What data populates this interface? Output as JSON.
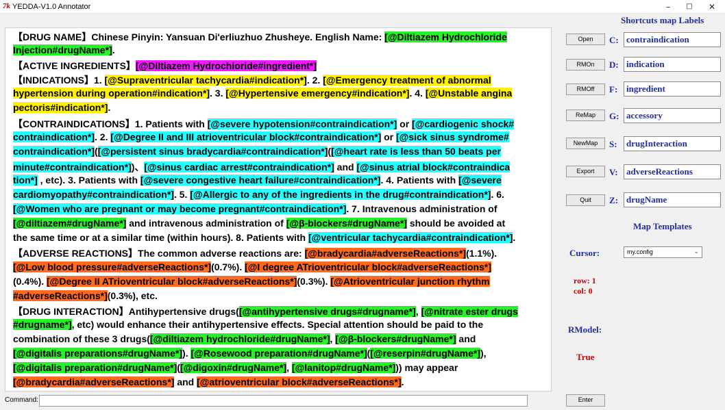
{
  "window": {
    "icon_text": "7k",
    "title": "YEDDA-V1.0 Annotator",
    "controls": [
      "–",
      "□",
      "✕"
    ]
  },
  "colors": {
    "drugName": "#2bef2b",
    "indication": "#fff200",
    "contraindication": "#27ffff",
    "ingredient": "#f218ff",
    "adverseReactions": "#ff6a1f",
    "label_blue": "#1f2fa0",
    "status_red": "#d00000"
  },
  "editor_lines": [
    [
      {
        "t": "【DRUG NAME】Chinese Pinyin: Yansuan Di'erliuzhuo Zhusheye. English Name: "
      },
      {
        "t": "[@Diltiazem Hydrochloride",
        "h": "g"
      }
    ],
    [
      {
        "t": "Injection#drugName*]",
        "h": "g"
      },
      {
        "t": "."
      }
    ],
    [
      {
        "t": "【ACTIVE INGREDIENTS】"
      },
      {
        "t": "[@Diltiazem Hydrochloride#ingredient*]",
        "h": "m"
      }
    ],
    [
      {
        "t": "【INDICATIONS】1. "
      },
      {
        "t": "[@Supraventricular tachycardia#indication*]",
        "h": "y"
      },
      {
        "t": ". 2. "
      },
      {
        "t": "[@Emergency treatment of abnormal",
        "h": "y"
      }
    ],
    [
      {
        "t": "hypertension during operation#indication*]",
        "h": "y"
      },
      {
        "t": ". 3. "
      },
      {
        "t": "[@Hypertensive emergency#indication*]",
        "h": "y"
      },
      {
        "t": ". 4. "
      },
      {
        "t": "[@Unstable angina",
        "h": "y"
      }
    ],
    [
      {
        "t": "pectoris#indication*]",
        "h": "y"
      },
      {
        "t": "."
      }
    ],
    [
      {
        "t": "【CONTRAINDICATIONS】1. Patients with "
      },
      {
        "t": "[@severe hypotension#contraindication*]",
        "h": "c"
      },
      {
        "t": " or "
      },
      {
        "t": "[@cardiogenic shock#",
        "h": "c"
      }
    ],
    [
      {
        "t": "contraindication*]",
        "h": "c"
      },
      {
        "t": ". 2. "
      },
      {
        "t": "[@Degree II and III atrioventricular block#contraindication*]",
        "h": "c"
      },
      {
        "t": " or "
      },
      {
        "t": "[@sick sinus syndrome#",
        "h": "c"
      }
    ],
    [
      {
        "t": "contraindication*]",
        "h": "c"
      },
      {
        "t": "("
      },
      {
        "t": "[@persistent sinus bradycardia#contraindication*]",
        "h": "c"
      },
      {
        "t": "("
      },
      {
        "t": "[@heart rate is less than 50 beats per",
        "h": "c"
      }
    ],
    [
      {
        "t": "minute#contraindication*]",
        "h": "c"
      },
      {
        "t": ")、"
      },
      {
        "t": "[@sinus cardiac arrest#contraindication*]",
        "h": "c"
      },
      {
        "t": " and "
      },
      {
        "t": "[@sinus atrial block#contraindica",
        "h": "c"
      }
    ],
    [
      {
        "t": "tion*]",
        "h": "c"
      },
      {
        "t": " , etc). 3. Patients with "
      },
      {
        "t": "[@severe congestive heart failure#contraindication*]",
        "h": "c"
      },
      {
        "t": ". 4.  Patients with "
      },
      {
        "t": "[@severe",
        "h": "c"
      }
    ],
    [
      {
        "t": "cardiomyopathy#contraindication*]",
        "h": "c"
      },
      {
        "t": ". 5.  "
      },
      {
        "t": "[@Allergic to any of the ingredients in the drug#contraindication*]",
        "h": "c"
      },
      {
        "t": ". 6."
      }
    ],
    [
      {
        "t": "[@Women who are pregnant or may become pregnant#contraindication*]",
        "h": "c"
      },
      {
        "t": ". 7. Intravenous administration of"
      }
    ],
    [
      {
        "t": "[@diltiazem#drugName*]",
        "h": "g"
      },
      {
        "t": " and intravenous administration of "
      },
      {
        "t": "[@β-blockers#drugName*]",
        "h": "g"
      },
      {
        "t": " should be avoided at"
      }
    ],
    [
      {
        "t": "the same time or at a similar time (within hours). 8.  Patients with "
      },
      {
        "t": "[@ventricular tachycardia#contraindication*]",
        "h": "c"
      },
      {
        "t": "."
      }
    ],
    [
      {
        "t": "【ADVERSE REACTIONS】The common adverse reactions are: "
      },
      {
        "t": "[@bradycardia#adverseReactions*]",
        "h": "o"
      },
      {
        "t": "(1.1%)."
      }
    ],
    [
      {
        "t": "[@Low blood pressure#adverseReactions*]",
        "h": "o"
      },
      {
        "t": "(0.7%). "
      },
      {
        "t": "[@I degree ATrioventricular block#adverseReactions*]",
        "h": "o"
      }
    ],
    [
      {
        "t": "(0.4%). "
      },
      {
        "t": "[@Degree II ATrioventricular block#adverseReactions*]",
        "h": "o"
      },
      {
        "t": "(0.3%). "
      },
      {
        "t": "[@Atrioventricular junction rhythm",
        "h": "o"
      }
    ],
    [
      {
        "t": "#adverseReactions*]",
        "h": "o"
      },
      {
        "t": "(0.3%), etc."
      }
    ],
    [
      {
        "t": "【DRUG INTERACTION】Antihypertensive drugs("
      },
      {
        "t": "[@antihypertensive drugs#drugname*]",
        "h": "g"
      },
      {
        "t": ", "
      },
      {
        "t": "[@nitrate ester drugs",
        "h": "g"
      }
    ],
    [
      {
        "t": "#drugname*]",
        "h": "g"
      },
      {
        "t": ", etc) would enhance their antihypertensive effects. Special attention should be paid to the"
      }
    ],
    [
      {
        "t": "combination of these 3 drugs("
      },
      {
        "t": "[@diltiazem hydrochloride#drugName*]",
        "h": "g"
      },
      {
        "t": ", "
      },
      {
        "t": "[@β-blockers#drugName*]",
        "h": "g"
      },
      {
        "t": " and"
      }
    ],
    [
      {
        "t": "[@digitalis preparations#drugName*]",
        "h": "g"
      },
      {
        "t": "). "
      },
      {
        "t": "[@Rosewood preparation#drugName*]",
        "h": "g"
      },
      {
        "t": "("
      },
      {
        "t": "[@reserpin#drugName*]",
        "h": "g"
      },
      {
        "t": "),"
      }
    ],
    [
      {
        "t": "[@digitalis preparation#drugName*]",
        "h": "g"
      },
      {
        "t": "("
      },
      {
        "t": "[@digoxin#drugName*]",
        "h": "g"
      },
      {
        "t": ", "
      },
      {
        "t": "[@lanitop#drugName*]",
        "h": "g"
      },
      {
        "t": ")) may appear"
      }
    ],
    [
      {
        "t": "[@bradycardia#adverseReactions*]",
        "h": "o"
      },
      {
        "t": " and "
      },
      {
        "t": "[@atrioventricular block#adverseReactions*]",
        "h": "o"
      },
      {
        "t": "."
      }
    ]
  ],
  "buttons": {
    "open": "Open",
    "rmon": "RMOn",
    "rmoff": "RMOff",
    "remap": "ReMap",
    "newmap": "NewMap",
    "export": "Export",
    "quit": "Quit",
    "enter": "Enter"
  },
  "shortcuts": {
    "header": "Shortcuts map Labels",
    "items": [
      {
        "key": "C:",
        "label": "contraindication"
      },
      {
        "key": "D:",
        "label": "indication"
      },
      {
        "key": "F:",
        "label": "ingredient"
      },
      {
        "key": "G:",
        "label": "accessory"
      },
      {
        "key": "S:",
        "label": "drugInteraction"
      },
      {
        "key": "V:",
        "label": "adverseReactions"
      },
      {
        "key": "Z:",
        "label": "drugName"
      }
    ]
  },
  "map_templates": {
    "header": "Map Templates",
    "selected": "my.config"
  },
  "status": {
    "cursor_label": "Cursor:",
    "row": "row: 1",
    "col": "col: 0",
    "rmodel_label": "RModel:",
    "rmodel_value": "True"
  },
  "command": {
    "label": "Command:",
    "value": ""
  }
}
